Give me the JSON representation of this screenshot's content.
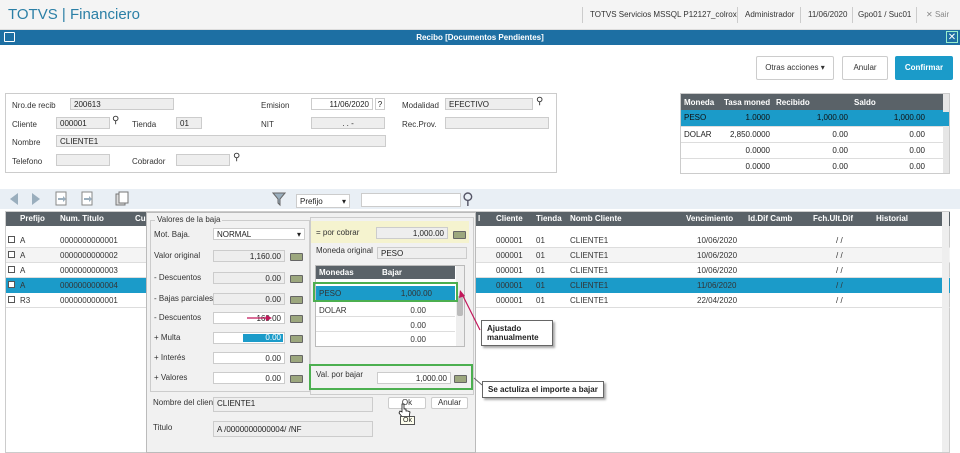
{
  "app": {
    "brand": "TOTVS | Financiero",
    "server": "TOTVS Servicios MSSQL P12127_colrox",
    "user": "Administrador",
    "date": "11/06/2020",
    "branch": "Gpo01 / Suc01",
    "exit": "Sair"
  },
  "window": {
    "title": "Recibo [Documentos Pendientes]",
    "close": "✕"
  },
  "actions": {
    "other": "Otras acciones",
    "cancel": "Anular",
    "confirm": "Confirmar"
  },
  "header": {
    "nro_label": "Nro.de recib",
    "nro_value": "200613",
    "emision_label": "Emision",
    "emision_value": "11/06/2020",
    "help": "?",
    "modalidad_label": "Modalidad",
    "modalidad_value": "EFECTIVO",
    "cliente_label": "Cliente",
    "cliente_value": "000001",
    "tienda_label": "Tienda",
    "tienda_value": "01",
    "nit_label": "NIT",
    "nit_value": ". . -",
    "recprov_label": "Rec.Prov.",
    "nombre_label": "Nombre",
    "nombre_value": "CLIENTE1",
    "telefono_label": "Telefono",
    "cobrador_label": "Cobrador"
  },
  "currency": {
    "headers": [
      "Moneda",
      "Tasa moned",
      "Recibido",
      "Saldo"
    ],
    "rows": [
      [
        "PESO",
        "1.0000",
        "1,000.00",
        "1,000.00"
      ],
      [
        "DOLAR",
        "2,850.0000",
        "0.00",
        "0.00"
      ],
      [
        "",
        "0.0000",
        "0.00",
        "0.00"
      ],
      [
        "",
        "0.0000",
        "0.00",
        "0.00"
      ]
    ]
  },
  "toolbar": {
    "filter_field": "Prefijo"
  },
  "grid": {
    "headers": [
      "",
      "Prefijo",
      "Num. Titulo",
      "Cu",
      "l",
      "Cliente",
      "Tienda",
      "Nomb Cliente",
      "Vencimiento",
      "Id.Dif Camb",
      "Fch.Ult.Dif",
      "Historial"
    ],
    "rows": [
      {
        "prefijo": "A",
        "titulo": "0000000000001",
        "cliente": "000001",
        "tienda": "01",
        "nombre": "CLIENTE1",
        "venc": "10/06/2020",
        "fch": "/ /"
      },
      {
        "prefijo": "A",
        "titulo": "0000000000002",
        "cliente": "000001",
        "tienda": "01",
        "nombre": "CLIENTE1",
        "venc": "10/06/2020",
        "fch": "/ /"
      },
      {
        "prefijo": "A",
        "titulo": "0000000000003",
        "cliente": "000001",
        "tienda": "01",
        "nombre": "CLIENTE1",
        "venc": "10/06/2020",
        "fch": "/ /"
      },
      {
        "prefijo": "A",
        "titulo": "0000000000004",
        "cliente": "000001",
        "tienda": "01",
        "nombre": "CLIENTE1",
        "venc": "11/06/2020",
        "fch": "/ /"
      },
      {
        "prefijo": "R3",
        "titulo": "0000000000001",
        "cliente": "000001",
        "tienda": "01",
        "nombre": "CLIENTE1",
        "venc": "22/04/2020",
        "fch": "/ /"
      }
    ]
  },
  "dialog": {
    "group_title": "Valores de la baja",
    "motbaja_label": "Mot. Baja.",
    "motbaja_value": "NORMAL",
    "valor_original_label": "Valor original",
    "valor_original": "1,160.00",
    "descuentos1_label": "- Descuentos",
    "descuentos1": "0.00",
    "bajas_label": "- Bajas parciales",
    "bajas": "0.00",
    "descuentos2_label": "- Descuentos",
    "descuentos2": "160.00",
    "multa_label": "+ Multa",
    "multa": "0.00",
    "interes_label": "+ Interés",
    "interes": "0.00",
    "valores_label": "+ Valores",
    "valores": "0.00",
    "por_cobrar_label": "= por cobrar",
    "por_cobrar": "1,000.00",
    "moneda_original_label": "Moneda original",
    "moneda_original": "PESO",
    "monedas_headers": [
      "Monedas",
      "Bajar"
    ],
    "monedas_rows": [
      [
        "PESO",
        "1,000.00"
      ],
      [
        "DOLAR",
        "0.00"
      ],
      [
        "",
        "0.00"
      ],
      [
        "",
        "0.00"
      ]
    ],
    "val_bajar_label": "Val. por bajar",
    "val_bajar": "1,000.00",
    "nombre_cliente_label": "Nombre del cliente",
    "nombre_cliente": "CLIENTE1",
    "titulo_label": "Titulo",
    "titulo": "A /0000000000004/ /NF",
    "ok": "Ok",
    "ok_tooltip": "Ok",
    "anular": "Anular"
  },
  "callouts": {
    "ajustado": "Ajustado manualmente",
    "actualiza": "Se actuliza el importe a bajar"
  },
  "colors": {
    "brand": "#2b7fa6",
    "accent": "#1b9bc9",
    "window_bar": "#1d6fa3",
    "highlight": "#4caf50",
    "arrow": "#c2185b"
  }
}
